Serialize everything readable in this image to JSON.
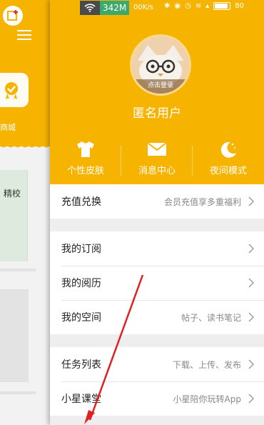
{
  "background_app": {
    "mall_label": "商城",
    "card_label": "精校"
  },
  "status_bar": {
    "data_usage": "342M",
    "net_speed": "00K/s",
    "battery_pct": "80"
  },
  "profile": {
    "login_tag": "点击登录",
    "username": "匿名用户"
  },
  "shortcuts": [
    {
      "icon": "tshirt-icon",
      "label": "个性皮肤"
    },
    {
      "icon": "envelope-icon",
      "label": "消息中心"
    },
    {
      "icon": "moon-icon",
      "label": "夜间模式"
    }
  ],
  "menu": {
    "recharge": {
      "label": "充值兑换",
      "sub": "会员充值享多重福利"
    },
    "subscriptions": {
      "label": "我的订阅",
      "sub": ""
    },
    "history": {
      "label": "我的阅历",
      "sub": ""
    },
    "space": {
      "label": "我的空间",
      "sub": "帖子、读书笔记"
    },
    "tasks": {
      "label": "任务列表",
      "sub": "下载、上传、发布"
    },
    "classroom": {
      "label": "小星课堂",
      "sub": "小星陪你玩转App"
    }
  },
  "colors": {
    "accent": "#f6b400",
    "annotation_arrow": "#e02020"
  }
}
